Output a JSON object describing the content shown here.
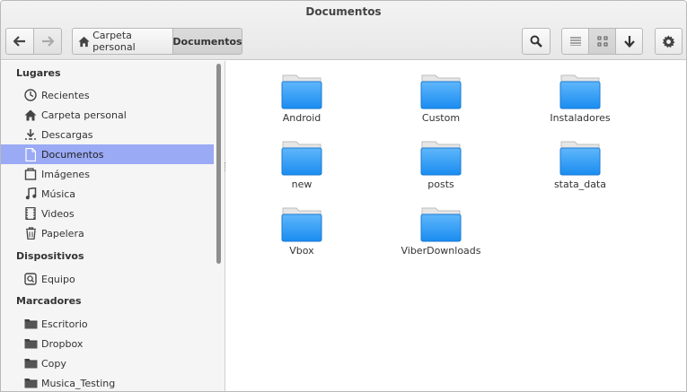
{
  "window": {
    "title": "Documentos"
  },
  "breadcrumb": {
    "home_label": "Carpeta personal",
    "current_label": "Documentos"
  },
  "sidebar": {
    "places_heading": "Lugares",
    "places": [
      {
        "label": "Recientes",
        "icon": "clock-icon"
      },
      {
        "label": "Carpeta personal",
        "icon": "home-icon"
      },
      {
        "label": "Descargas",
        "icon": "download-icon"
      },
      {
        "label": "Documentos",
        "icon": "document-icon",
        "selected": true
      },
      {
        "label": "Imágenes",
        "icon": "image-icon"
      },
      {
        "label": "Música",
        "icon": "music-icon"
      },
      {
        "label": "Videos",
        "icon": "film-icon"
      },
      {
        "label": "Papelera",
        "icon": "trash-icon"
      }
    ],
    "devices_heading": "Dispositivos",
    "devices": [
      {
        "label": "Equipo",
        "icon": "drive-icon"
      }
    ],
    "bookmarks_heading": "Marcadores",
    "bookmarks": [
      {
        "label": "Escritorio",
        "icon": "folder-icon"
      },
      {
        "label": "Dropbox",
        "icon": "folder-icon"
      },
      {
        "label": "Copy",
        "icon": "folder-icon"
      },
      {
        "label": "Musica_Testing",
        "icon": "folder-icon"
      }
    ]
  },
  "files": [
    {
      "name": "Android"
    },
    {
      "name": "Custom"
    },
    {
      "name": "Instaladores"
    },
    {
      "name": "new"
    },
    {
      "name": "posts"
    },
    {
      "name": "stata_data"
    },
    {
      "name": "Vbox"
    },
    {
      "name": "ViberDownloads"
    }
  ],
  "colors": {
    "accent": "#9aaaf5",
    "folder_top": "#5fb7fb",
    "folder_bottom": "#1a8cf0"
  }
}
